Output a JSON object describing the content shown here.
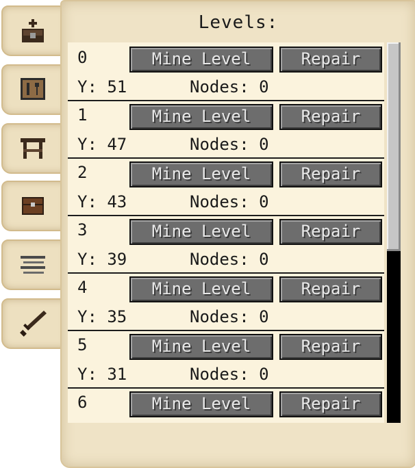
{
  "panel": {
    "title": "Levels:"
  },
  "tabs": [
    {
      "icon": "gift-chest-icon"
    },
    {
      "icon": "tool-board-icon"
    },
    {
      "icon": "workbench-icon"
    },
    {
      "icon": "storage-chest-icon"
    },
    {
      "icon": "stacked-layers-icon"
    },
    {
      "icon": "sword-icon"
    }
  ],
  "buttons": {
    "mine_label": "Mine Level",
    "repair_label": "Repair"
  },
  "levels": [
    {
      "index": "0",
      "y": "Y: 51",
      "nodes": "Nodes: 0"
    },
    {
      "index": "1",
      "y": "Y: 47",
      "nodes": "Nodes: 0"
    },
    {
      "index": "2",
      "y": "Y: 43",
      "nodes": "Nodes: 0"
    },
    {
      "index": "3",
      "y": "Y: 39",
      "nodes": "Nodes: 0"
    },
    {
      "index": "4",
      "y": "Y: 35",
      "nodes": "Nodes: 0"
    },
    {
      "index": "5",
      "y": "Y: 31",
      "nodes": "Nodes: 0"
    },
    {
      "index": "6"
    }
  ],
  "colors": {
    "parchment": "#efe3c6",
    "list_background": "#fbf3dd",
    "button_face": "#6d6d6d",
    "button_text": "#e8e8e8",
    "scroll_track": "#000000",
    "scroll_thumb": "#c6c6c6"
  }
}
